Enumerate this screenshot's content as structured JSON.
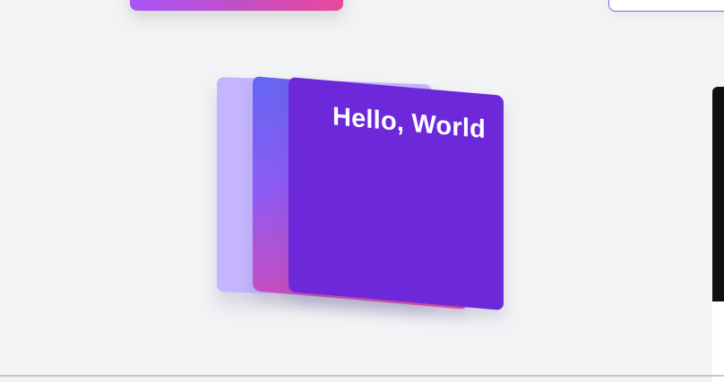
{
  "cards": {
    "front": {
      "title": "Hello, World"
    }
  }
}
